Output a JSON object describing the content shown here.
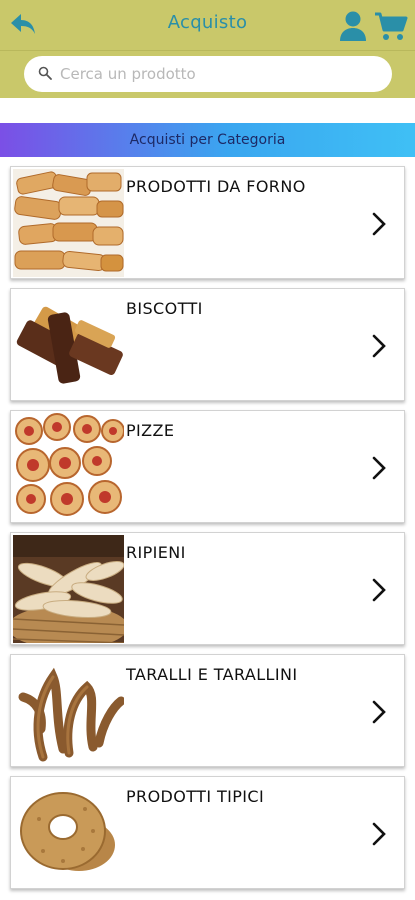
{
  "header": {
    "title": "Acquisto",
    "back_icon": "back-arrow-icon",
    "user_icon": "user-icon",
    "cart_icon": "cart-icon",
    "bar_color": "#c9c86a",
    "accent_color": "#2a8fa8"
  },
  "search": {
    "placeholder": "Cerca un prodotto",
    "value": ""
  },
  "section": {
    "title": "Acquisti per Categoria"
  },
  "categories": [
    {
      "label": "PRODOTTI DA FORNO",
      "image": "biscotti-cantucci-photo"
    },
    {
      "label": "BISCOTTI",
      "image": "biscotti-bicolore-photo"
    },
    {
      "label": "PIZZE",
      "image": "pizzette-girelle-photo"
    },
    {
      "label": "RIPIENI",
      "image": "ripieni-basket-photo"
    },
    {
      "label": "TARALLI E TARALLINI",
      "image": "taralli-photo"
    },
    {
      "label": "PRODOTTI TIPICI",
      "image": "tarallo-ring-photo"
    }
  ]
}
